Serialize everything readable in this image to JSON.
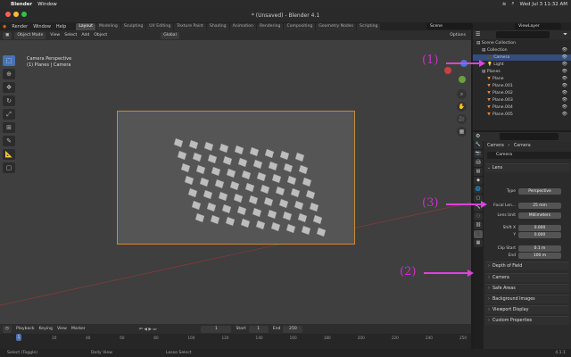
{
  "mac_menu": {
    "app": "Blender",
    "items": [
      "Window"
    ],
    "clock": "Wed Jul 3  11:32 AM"
  },
  "window_title": "* (Unsaved) - Blender 4.1",
  "menubar": {
    "items": [
      "Render",
      "Window",
      "Help"
    ]
  },
  "workspaces": [
    "Layout",
    "Modeling",
    "Sculpting",
    "UV Editing",
    "Texture Paint",
    "Shading",
    "Animation",
    "Rendering",
    "Compositing",
    "Geometry Nodes",
    "Scripting"
  ],
  "active_workspace": "Layout",
  "scene_name": "Scene",
  "view_layer": "ViewLayer",
  "viewport_header": {
    "mode": "Object Mode",
    "menus": [
      "View",
      "Select",
      "Add",
      "Object"
    ],
    "orientation": "Global",
    "options": "Options"
  },
  "viewport_info": {
    "line1": "Camera Perspective",
    "line2": "(1) Planes | Camera"
  },
  "outliner": {
    "title": "Scene Collection",
    "rows": [
      {
        "label": "Collection",
        "level": 1
      },
      {
        "label": "Camera",
        "level": 2,
        "selected": true
      },
      {
        "label": "Light",
        "level": 2
      },
      {
        "label": "Planes",
        "level": 1
      },
      {
        "label": "Plane",
        "level": 2
      },
      {
        "label": "Plane.001",
        "level": 2
      },
      {
        "label": "Plane.002",
        "level": 2
      },
      {
        "label": "Plane.003",
        "level": 2
      },
      {
        "label": "Plane.004",
        "level": 2
      },
      {
        "label": "Plane.005",
        "level": 2
      }
    ]
  },
  "properties": {
    "breadcrumb": [
      "Camera",
      "Camera"
    ],
    "datablock": "Camera",
    "lens_section": "Lens",
    "fields": [
      {
        "label": "Type",
        "value": "Perspective"
      },
      {
        "label": "Focal Len...",
        "value": "25 mm"
      },
      {
        "label": "Lens Unit",
        "value": "Millimeters"
      },
      {
        "label": "Shift X",
        "value": "0.000"
      },
      {
        "label": "Y",
        "value": "0.000"
      },
      {
        "label": "Clip Start",
        "value": "0.1 m"
      },
      {
        "label": "End",
        "value": "100 m"
      }
    ],
    "sections": [
      "Depth of Field",
      "Camera",
      "Safe Areas",
      "Background Images",
      "Viewport Display",
      "Custom Properties"
    ]
  },
  "timeline": {
    "menus": [
      "Playback",
      "Keying",
      "View",
      "Marker"
    ],
    "current_frame": "1",
    "start_label": "Start",
    "start": "1",
    "end_label": "End",
    "end": "250",
    "ticks": [
      "1",
      "20",
      "40",
      "60",
      "80",
      "100",
      "120",
      "140",
      "160",
      "180",
      "200",
      "220",
      "240",
      "250"
    ]
  },
  "statusbar": {
    "left": "Select (Toggle)",
    "mid": "Dolly View",
    "right": "Lasso Select",
    "version": "4.1.1"
  },
  "annotations": [
    "(1)",
    "(2)",
    "(3)"
  ],
  "colors": {
    "accent": "#4772b3",
    "annotation": "#cc2fc8",
    "camera_frame": "#c88a3a"
  }
}
